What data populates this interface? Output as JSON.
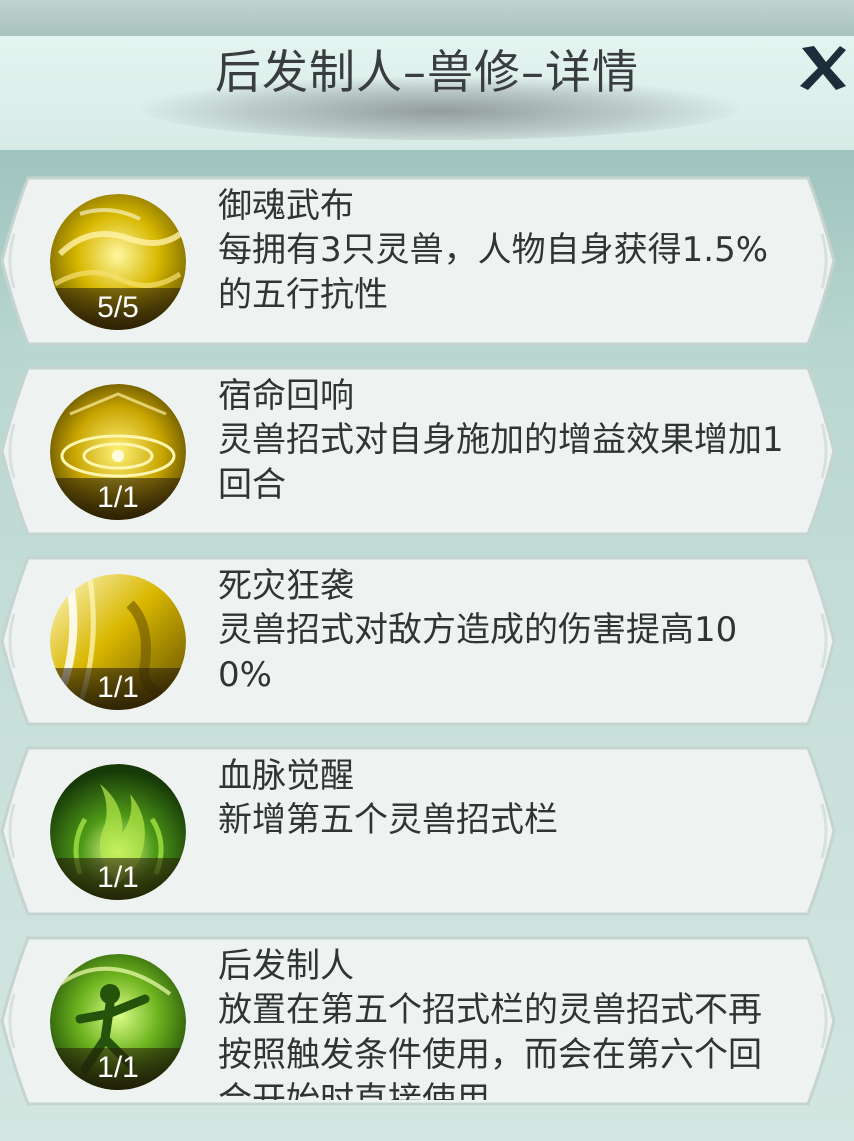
{
  "header": {
    "title": "后发制人–兽修–详情",
    "close_icon": "close-x-icon"
  },
  "cards": [
    {
      "name": "御魂武布",
      "desc": "每拥有3只灵兽，人物自身获得1.5%的五行抗性",
      "count": "5/5",
      "theme": "gold-swirl"
    },
    {
      "name": "宿命回响",
      "desc": "灵兽招式对自身施加的增益效果增加1回合",
      "count": "1/1",
      "theme": "gold-runes"
    },
    {
      "name": "死灾狂袭",
      "desc": "灵兽招式对敌方造成的伤害提高100%",
      "count": "1/1",
      "theme": "gold-slash"
    },
    {
      "name": "血脉觉醒",
      "desc": "新增第五个灵兽招式栏",
      "count": "1/1",
      "theme": "green-flame"
    },
    {
      "name": "后发制人",
      "desc": "放置在第五个招式栏的灵兽招式不再按照触发条件使用，而会在第六个回合开始时直接使用",
      "count": "1/1",
      "theme": "green-figure"
    }
  ],
  "colors": {
    "gold": "#d8b600",
    "green": "#6aa81c"
  }
}
